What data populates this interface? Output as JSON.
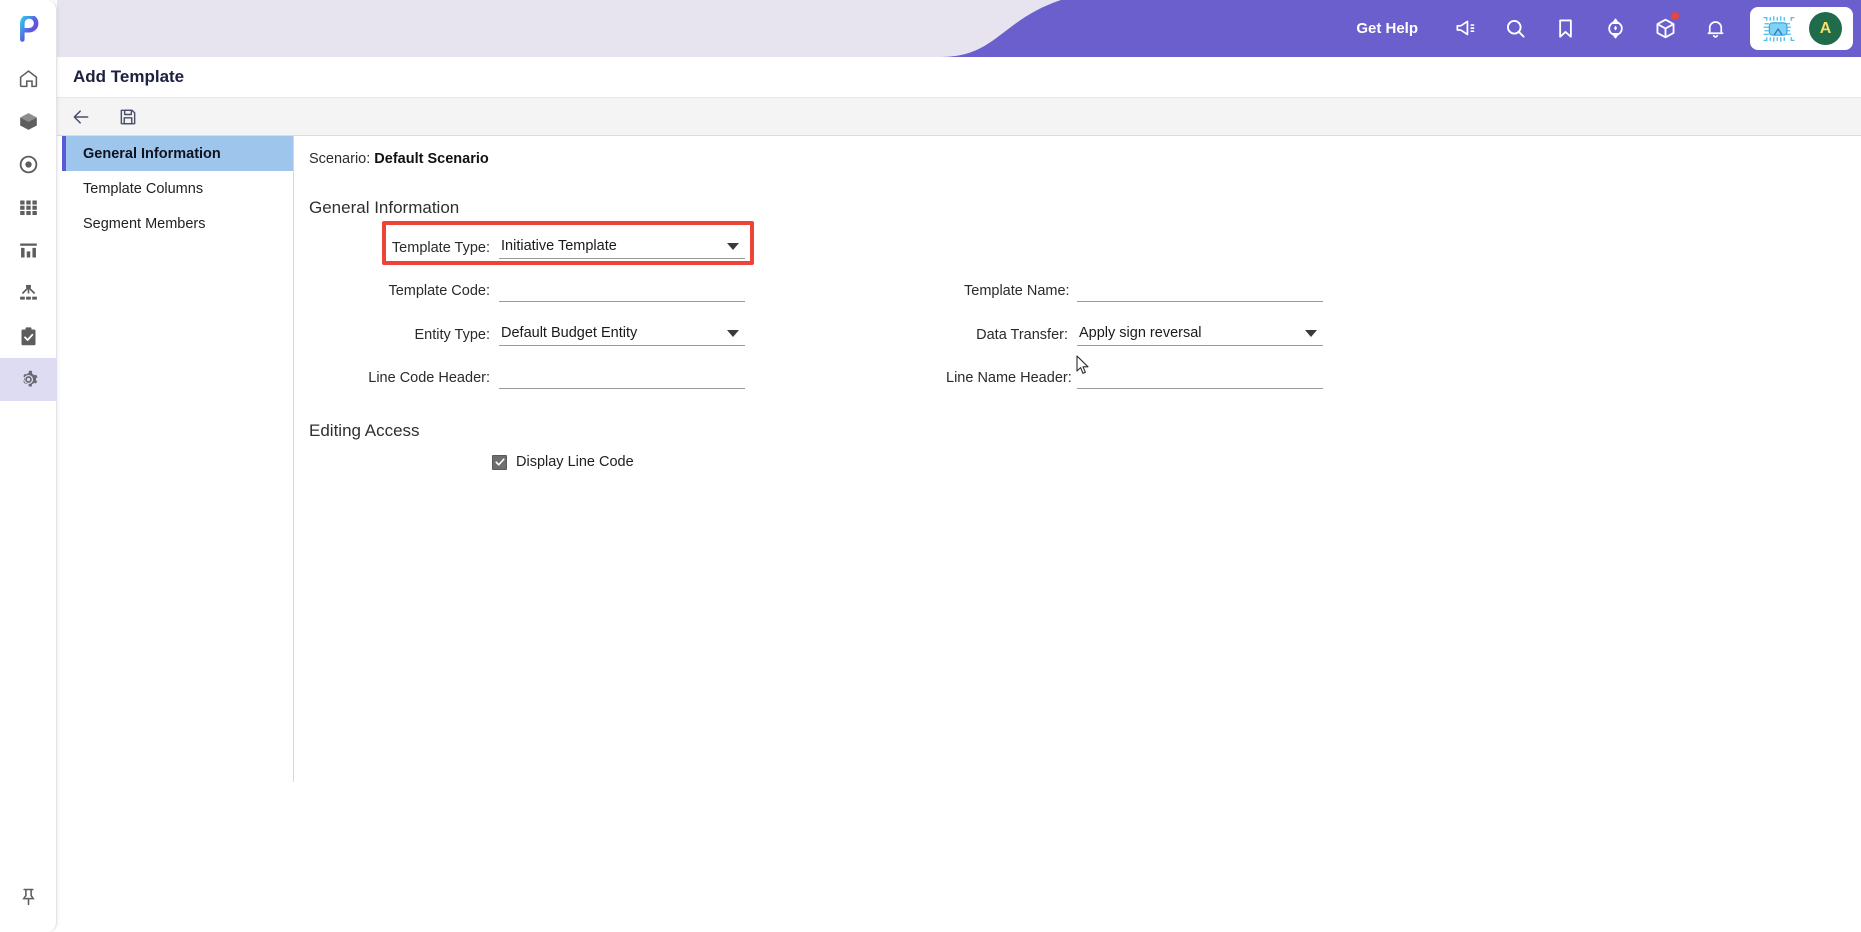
{
  "app": {
    "logo_name": "pigment-logo",
    "page_title": "Add Template"
  },
  "header": {
    "get_help_label": "Get Help",
    "actions": [
      {
        "name": "announcements-icon",
        "label": "Announcements"
      },
      {
        "name": "search-icon",
        "label": "Search"
      },
      {
        "name": "bookmark-icon",
        "label": "Bookmarks"
      },
      {
        "name": "shortcuts-icon",
        "label": "Shortcuts"
      },
      {
        "name": "cube-icon",
        "label": "Apps",
        "badge": true
      },
      {
        "name": "bell-icon",
        "label": "Notifications"
      }
    ],
    "ai_chip_icon": "ai-chip-icon",
    "avatar_initial": "A"
  },
  "toolbar": {
    "back_label": "Back",
    "save_label": "Save"
  },
  "subnav": {
    "items": [
      {
        "label": "General Information",
        "active": true
      },
      {
        "label": "Template Columns",
        "active": false
      },
      {
        "label": "Segment Members",
        "active": false
      }
    ]
  },
  "rail": {
    "items": [
      {
        "name": "home-icon",
        "label": "Home",
        "active": false
      },
      {
        "name": "cube-icon",
        "label": "Models",
        "active": false
      },
      {
        "name": "target-icon",
        "label": "Tracking",
        "active": false
      },
      {
        "name": "grid-icon",
        "label": "Grids",
        "active": false
      },
      {
        "name": "chart-icon",
        "label": "Reports",
        "active": false
      },
      {
        "name": "hierarchy-icon",
        "label": "Hierarchy",
        "active": false
      },
      {
        "name": "clipboard-check-icon",
        "label": "Tasks",
        "active": false
      },
      {
        "name": "gear-icon",
        "label": "Settings",
        "active": true
      }
    ],
    "pin_label": "Pin sidebar"
  },
  "form": {
    "scenario_label": "Scenario:",
    "scenario_value": "Default Scenario",
    "section_general": "General Information",
    "section_editing": "Editing Access",
    "fields": {
      "template_type": {
        "label": "Template Type:",
        "value": "Initiative Template",
        "type": "select",
        "highlighted": true
      },
      "template_code": {
        "label": "Template Code:",
        "value": "",
        "placeholder": "",
        "type": "input"
      },
      "entity_type": {
        "label": "Entity Type:",
        "value": "Default Budget Entity",
        "type": "select"
      },
      "line_code_header": {
        "label": "Line Code Header:",
        "value": "",
        "placeholder": "",
        "type": "input"
      },
      "template_name": {
        "label": "Template Name:",
        "value": "",
        "placeholder": "",
        "type": "input"
      },
      "data_transfer": {
        "label": "Data Transfer:",
        "value": "Apply sign reversal",
        "type": "select"
      },
      "line_name_header": {
        "label": "Line Name Header:",
        "value": "",
        "placeholder": "",
        "type": "input"
      }
    },
    "display_line_code": {
      "label": "Display Line Code",
      "checked": true
    }
  },
  "colors": {
    "brand_purple": "#6b5fce",
    "banner_light": "#e7e4ef",
    "active_tab_blue": "#9ec5ec",
    "active_tab_border": "#5a5ad6",
    "highlight_red": "#ef4338",
    "rail_active": "#dedcf2",
    "title_navy": "#1c2140",
    "avatar_green": "#1f6b4a"
  }
}
